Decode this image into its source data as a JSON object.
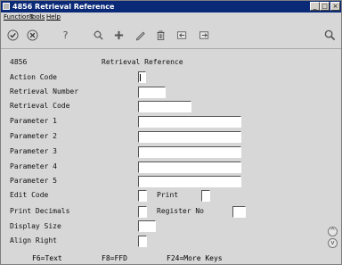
{
  "window": {
    "title": "4856   Retrieval Reference",
    "min_glyph": "_",
    "max_glyph": "□",
    "close_glyph": "×"
  },
  "menu": {
    "functions": "Functions",
    "tools": "Tools",
    "help": "Help"
  },
  "toolbar": {
    "icons": [
      "check-icon",
      "cancel-icon",
      "help-icon",
      "display-icon",
      "add-icon",
      "edit-icon",
      "delete-icon",
      "previous-icon",
      "next-icon",
      "search-icon"
    ],
    "help_glyph": "?"
  },
  "form": {
    "screen_id": "4856",
    "screen_title": "Retrieval Reference",
    "action_code": "Action Code",
    "retrieval_number": "Retrieval Number",
    "retrieval_code": "Retrieval Code",
    "parameter_1": "Parameter 1",
    "parameter_2": "Parameter 2",
    "parameter_3": "Parameter 3",
    "parameter_4": "Parameter 4",
    "parameter_5": "Parameter 5",
    "edit_code": "Edit Code",
    "print": "Print",
    "print_decimals": "Print Decimals",
    "register_no": "Register No",
    "display_size": "Display Size",
    "align_right": "Align Right"
  },
  "fkeys": {
    "f6": "F6=Text",
    "f8": "F8=FFD",
    "f24": "F24=More Keys"
  },
  "scroll": {
    "up_glyph": "^",
    "down_glyph": "v"
  },
  "colors": {
    "titlebar": "#0a2a78",
    "window_bg": "#d7d7d7",
    "field_bg": "#ffffff"
  }
}
